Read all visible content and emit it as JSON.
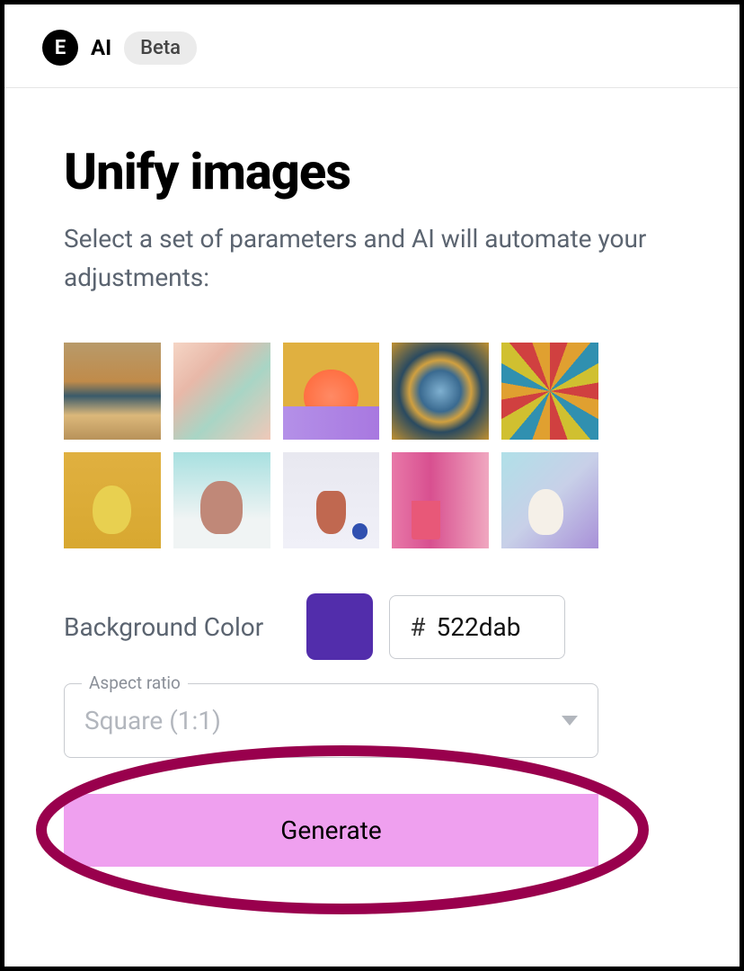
{
  "header": {
    "logo_letter": "E",
    "ai_label": "AI",
    "beta_label": "Beta"
  },
  "page": {
    "title": "Unify images",
    "subtitle": "Select a set of parameters and AI will automate your adjustments:"
  },
  "thumbnails": [
    {
      "name": "image-1-vase-gradient"
    },
    {
      "name": "image-2-stacked-cups"
    },
    {
      "name": "image-3-orange-plant"
    },
    {
      "name": "image-4-decorative-plate"
    },
    {
      "name": "image-5-colorful-vases"
    },
    {
      "name": "image-6-yellow-vase"
    },
    {
      "name": "image-7-terracotta-vase"
    },
    {
      "name": "image-8-small-vase"
    },
    {
      "name": "image-9-pink-plant"
    },
    {
      "name": "image-10-white-vase"
    }
  ],
  "background_color": {
    "label": "Background Color",
    "swatch_hex": "#522dab",
    "prefix": "#",
    "value": "522dab"
  },
  "aspect_ratio": {
    "legend": "Aspect ratio",
    "selected_label": "Square (1:1)"
  },
  "actions": {
    "generate_label": "Generate"
  },
  "annotation": {
    "ellipse_color": "#99004d"
  }
}
